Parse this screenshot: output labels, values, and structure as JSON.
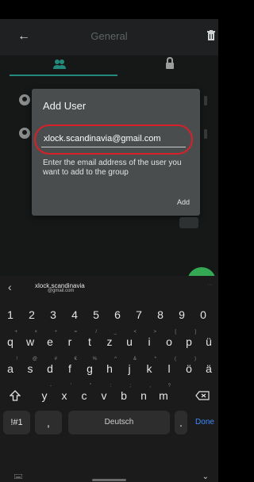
{
  "app": {
    "title": "General"
  },
  "dialog": {
    "title": "Add User",
    "email_value": "xlock.scandinavia@gmail.com",
    "hint": "Enter the email address of the user you want to add to the group",
    "add_label": "Add"
  },
  "keyboard": {
    "suggestion_main": "xlock.scandinavia",
    "suggestion_sub": "@gmail.com",
    "numbers": [
      "1",
      "2",
      "3",
      "4",
      "5",
      "6",
      "7",
      "8",
      "9",
      "0"
    ],
    "row1": [
      "q",
      "w",
      "e",
      "r",
      "t",
      "z",
      "u",
      "i",
      "o",
      "p",
      "ü"
    ],
    "row1_sups": [
      "+",
      "×",
      "÷",
      "=",
      "/",
      "_",
      "<",
      ">",
      "[",
      "]",
      ""
    ],
    "row2": [
      "a",
      "s",
      "d",
      "f",
      "g",
      "h",
      "j",
      "k",
      "l",
      "ö",
      "ä"
    ],
    "row2_sups": [
      "!",
      "@",
      "#",
      "€",
      "%",
      "^",
      "&",
      "*",
      "(",
      ")",
      ""
    ],
    "row3": [
      "y",
      "x",
      "c",
      "v",
      "b",
      "n",
      "m"
    ],
    "row3_sups": [
      "-",
      "'",
      "\"",
      ":",
      ";",
      ",",
      "?"
    ],
    "symbols_label": "!#1",
    "comma": ",",
    "space_label": "Deutsch",
    "period": ".",
    "done_label": "Done"
  },
  "colors": {
    "accent": "#2fb8a4",
    "fab": "#34a853",
    "highlight_circle": "#d8202a",
    "done": "#3d8bfd"
  },
  "icons": {
    "back": "arrow-left-icon",
    "trash": "trash-icon",
    "members_tab": "group-icon",
    "lock_tab": "lock-icon",
    "fab": "menu-icon",
    "shift": "shift-icon",
    "backspace": "backspace-icon"
  }
}
